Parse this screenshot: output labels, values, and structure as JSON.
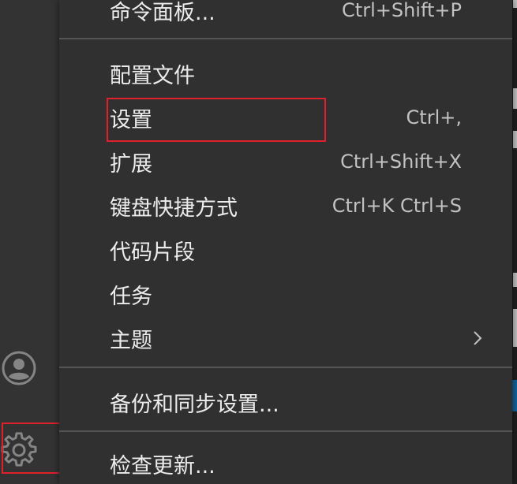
{
  "menu": {
    "items": [
      {
        "label": "命令面板...",
        "shortcut": "Ctrl+Shift+P"
      },
      {
        "label": "配置文件",
        "shortcut": ""
      },
      {
        "label": "设置",
        "shortcut": "Ctrl+,"
      },
      {
        "label": "扩展",
        "shortcut": "Ctrl+Shift+X"
      },
      {
        "label": "键盘快捷方式",
        "shortcut": "Ctrl+K Ctrl+S"
      },
      {
        "label": "代码片段",
        "shortcut": ""
      },
      {
        "label": "任务",
        "shortcut": ""
      },
      {
        "label": "主题",
        "shortcut": ""
      },
      {
        "label": "备份和同步设置...",
        "shortcut": ""
      },
      {
        "label": "检查更新...",
        "shortcut": ""
      }
    ]
  },
  "activity_bar": {
    "accounts_icon": "account-icon",
    "manage_icon": "gear-icon"
  },
  "colors": {
    "menu_background": "#303031",
    "activity_bar": "#333333",
    "highlight": "#e0212b"
  }
}
